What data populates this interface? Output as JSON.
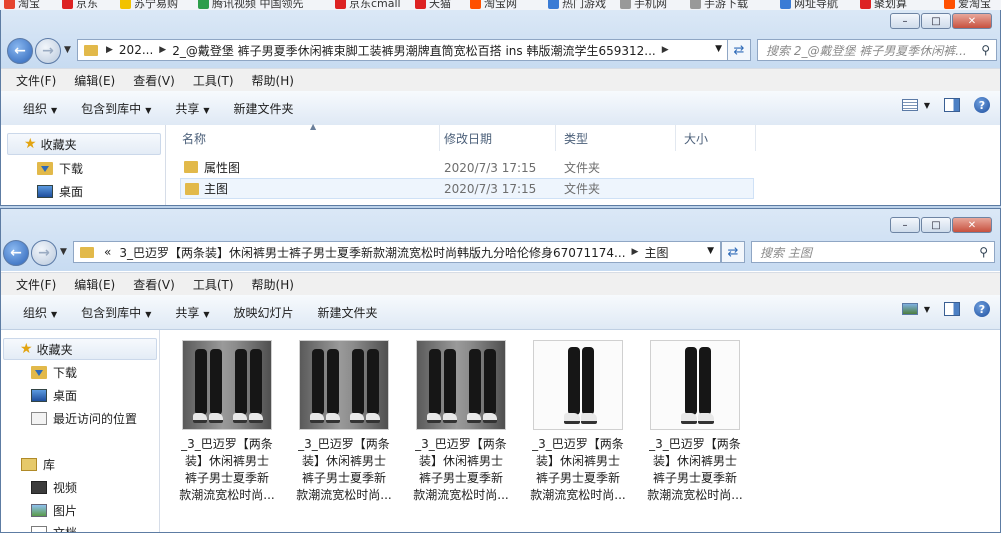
{
  "bookmarks": [
    "淘宝",
    "京东",
    "苏宁易购",
    "腾讯视频 中国领先",
    "京东cmall",
    "天猫",
    "淘宝网",
    "热门游戏",
    "手机网",
    "手游下载",
    "网址导航",
    "聚划算",
    "爱淘宝"
  ],
  "window1": {
    "caption_buttons": {
      "minimize": "–",
      "maximize": "□",
      "close": "✕"
    },
    "address": {
      "crumbs": [
        "202...",
        "2_@戴登堡 裤子男夏季休闲裤束脚工装裤男潮牌直筒宽松百搭 ins 韩版潮流学生659312..."
      ]
    },
    "search_placeholder": "搜索 2_@戴登堡 裤子男夏季休闲裤...",
    "menu": [
      "文件(F)",
      "编辑(E)",
      "查看(V)",
      "工具(T)",
      "帮助(H)"
    ],
    "commands": [
      "组织",
      "包含到库中",
      "共享",
      "新建文件夹"
    ],
    "sidebar": {
      "favorites": "收藏夹",
      "items": [
        "下载",
        "桌面"
      ]
    },
    "columns": [
      "名称",
      "修改日期",
      "类型",
      "大小"
    ],
    "rows": [
      {
        "name": "属性图",
        "date": "2020/7/3 17:15",
        "type": "文件夹",
        "size": ""
      },
      {
        "name": "主图",
        "date": "2020/7/3 17:15",
        "type": "文件夹",
        "size": ""
      }
    ]
  },
  "window2": {
    "caption_buttons": {
      "minimize": "–",
      "maximize": "□",
      "close": "✕"
    },
    "address": {
      "prefix": "«",
      "crumbs": [
        "3_巴迈罗【两条装】休闲裤男士裤子男士夏季新款潮流宽松时尚韩版九分哈伦修身67071174...",
        "主图"
      ]
    },
    "search_placeholder": "搜索 主图",
    "menu": [
      "文件(F)",
      "编辑(E)",
      "查看(V)",
      "工具(T)",
      "帮助(H)"
    ],
    "commands": [
      "组织",
      "包含到库中",
      "共享",
      "放映幻灯片",
      "新建文件夹"
    ],
    "sidebar": {
      "favorites": "收藏夹",
      "favorite_items": [
        "下载",
        "桌面",
        "最近访问的位置"
      ],
      "library": "库",
      "library_items": [
        "视频",
        "图片",
        "文档"
      ]
    },
    "thumbnails": [
      {
        "label": [
          "_3_巴迈罗【两条",
          "装】休闲裤男士",
          "裤子男士夏季新",
          "款潮流宽松时尚..."
        ],
        "style": "gray-pair"
      },
      {
        "label": [
          "_3_巴迈罗【两条",
          "装】休闲裤男士",
          "裤子男士夏季新",
          "款潮流宽松时尚..."
        ],
        "style": "gray-pair"
      },
      {
        "label": [
          "_3_巴迈罗【两条",
          "装】休闲裤男士",
          "裤子男士夏季新",
          "款潮流宽松时尚..."
        ],
        "style": "gray-pair"
      },
      {
        "label": [
          "_3_巴迈罗【两条",
          "装】休闲裤男士",
          "裤子男士夏季新",
          "款潮流宽松时尚..."
        ],
        "style": "white-single"
      },
      {
        "label": [
          "_3_巴迈罗【两条",
          "装】休闲裤男士",
          "裤子男士夏季新",
          "款潮流宽松时尚..."
        ],
        "style": "white-single"
      }
    ]
  },
  "colors": {
    "frame": "#c7dbf1",
    "accent": "#2e6ab8",
    "folder": "#e2b94a",
    "selection": "#eef5fd"
  }
}
